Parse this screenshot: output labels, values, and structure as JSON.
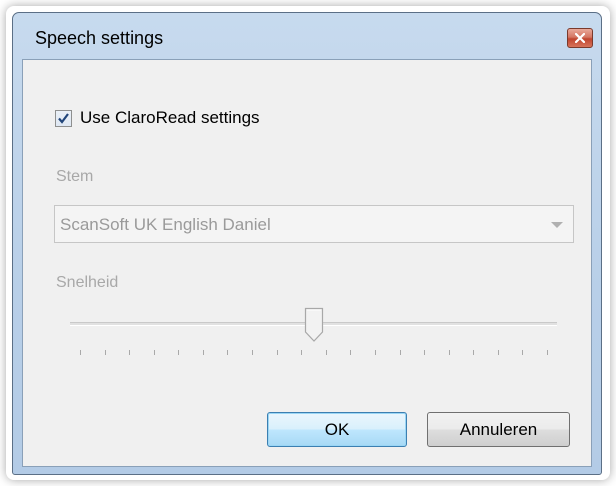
{
  "window": {
    "title": "Speech settings",
    "close_icon": "close-x-icon"
  },
  "settings": {
    "use_claroread": {
      "label": "Use ClaroRead settings",
      "checked": true
    },
    "voice": {
      "label": "Stem",
      "selected": "ScanSoft UK English Daniel",
      "enabled": false
    },
    "speed": {
      "label": "Snelheid",
      "value_fraction": 0.5,
      "tick_count": 20,
      "enabled": false
    }
  },
  "buttons": {
    "ok": "OK",
    "cancel": "Annuleren"
  },
  "colors": {
    "titlebar": "#b9d0e9",
    "close_button": "#c9503a",
    "default_button_border": "#3c7fb1",
    "disabled_text": "#a8a8a8"
  }
}
